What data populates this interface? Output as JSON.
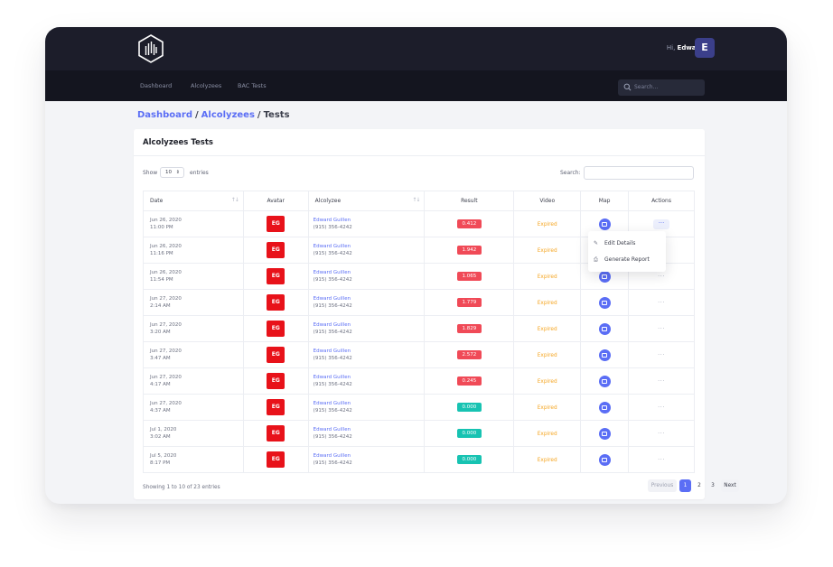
{
  "header": {
    "greeting": "Hi,",
    "user_name": "Edward",
    "user_initial": "E"
  },
  "nav": {
    "items": [
      "Dashboard",
      "Alcolyzees",
      "BAC Tests"
    ],
    "search_placeholder": "Search..."
  },
  "breadcrumb": {
    "items": [
      "Dashboard",
      "Alcolyzees",
      "Tests"
    ],
    "separator": "/"
  },
  "card": {
    "title": "Alcolyzees Tests",
    "show_label": "Show",
    "page_size": "10",
    "entries_label": "entries",
    "search_label": "Search:"
  },
  "table": {
    "columns": [
      "Date",
      "Avatar",
      "Alcolyzee",
      "Result",
      "Video",
      "Map",
      "Actions"
    ],
    "rows": [
      {
        "date": "Jun 26, 2020",
        "time": "11:00 PM",
        "avatar": "EG",
        "name": "Edward Guillen",
        "phone": "(915) 356-4242",
        "result": "0.412",
        "result_status": "red",
        "video": "Expired"
      },
      {
        "date": "Jun 26, 2020",
        "time": "11:16 PM",
        "avatar": "EG",
        "name": "Edward Guillen",
        "phone": "(915) 356-4242",
        "result": "1.942",
        "result_status": "red",
        "video": "Expired"
      },
      {
        "date": "Jun 26, 2020",
        "time": "11:54 PM",
        "avatar": "EG",
        "name": "Edward Guillen",
        "phone": "(915) 356-4242",
        "result": "1.065",
        "result_status": "red",
        "video": "Expired"
      },
      {
        "date": "Jun 27, 2020",
        "time": "2:14 AM",
        "avatar": "EG",
        "name": "Edward Guillen",
        "phone": "(915) 356-4242",
        "result": "1.779",
        "result_status": "red",
        "video": "Expired"
      },
      {
        "date": "Jun 27, 2020",
        "time": "3:20 AM",
        "avatar": "EG",
        "name": "Edward Guillen",
        "phone": "(915) 356-4242",
        "result": "1.829",
        "result_status": "red",
        "video": "Expired"
      },
      {
        "date": "Jun 27, 2020",
        "time": "3:47 AM",
        "avatar": "EG",
        "name": "Edward Guillen",
        "phone": "(915) 356-4242",
        "result": "2.572",
        "result_status": "red",
        "video": "Expired"
      },
      {
        "date": "Jun 27, 2020",
        "time": "4:17 AM",
        "avatar": "EG",
        "name": "Edward Guillen",
        "phone": "(915) 356-4242",
        "result": "0.245",
        "result_status": "red",
        "video": "Expired"
      },
      {
        "date": "Jun 27, 2020",
        "time": "4:37 AM",
        "avatar": "EG",
        "name": "Edward Guillen",
        "phone": "(915) 356-4242",
        "result": "0.000",
        "result_status": "teal",
        "video": "Expired"
      },
      {
        "date": "Jul 1, 2020",
        "time": "3:02 AM",
        "avatar": "EG",
        "name": "Edward Guillen",
        "phone": "(915) 356-4242",
        "result": "0.000",
        "result_status": "teal",
        "video": "Expired"
      },
      {
        "date": "Jul 5, 2020",
        "time": "8:17 PM",
        "avatar": "EG",
        "name": "Edward Guillen",
        "phone": "(915) 356-4242",
        "result": "0.000",
        "result_status": "teal",
        "video": "Expired"
      }
    ]
  },
  "actions_menu": {
    "items": [
      "Edit Details",
      "Generate Report"
    ]
  },
  "footer": {
    "showing": "Showing 1 to 10 of 23 entries"
  },
  "pagination": {
    "previous": "Previous",
    "pages": [
      "1",
      "2",
      "3"
    ],
    "next": "Next",
    "current": "1"
  },
  "colors": {
    "accent": "#5b6ef5",
    "topbar": "#1c1d2a",
    "danger": "#f04a57",
    "success": "#17c3b2",
    "warning": "#f5a623",
    "avatar_bg": "#e8121a"
  }
}
